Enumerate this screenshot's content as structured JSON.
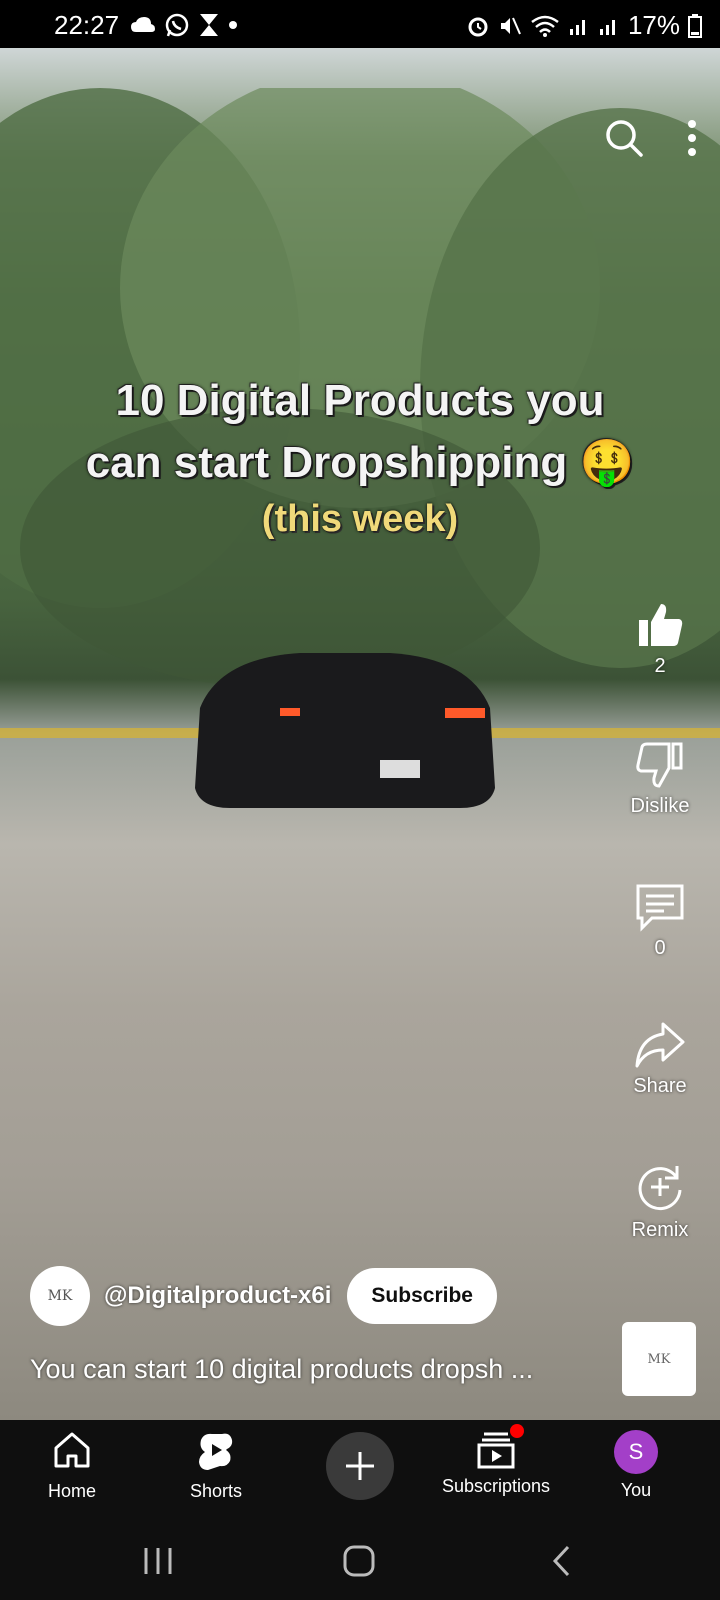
{
  "status": {
    "time": "22:27",
    "battery_pct": "17%"
  },
  "video": {
    "overlay_line1": "10 Digital Products you",
    "overlay_line2": "can start Dropshipping 🤑",
    "overlay_line3": "(this week)"
  },
  "actions": {
    "like_count": "2",
    "dislike_label": "Dislike",
    "comment_count": "0",
    "share_label": "Share",
    "remix_label": "Remix"
  },
  "channel": {
    "avatar_text": "MK",
    "handle": "@Digitalproduct-x6i",
    "subscribe_label": "Subscribe"
  },
  "title": "You can start 10 digital products dropsh ...",
  "thumb_text": "MK",
  "nav": {
    "home": "Home",
    "shorts": "Shorts",
    "subscriptions": "Subscriptions",
    "you": "You",
    "you_initial": "S"
  },
  "colors": {
    "nav_bg": "#0f0f0f",
    "notification_dot": "#ff0000",
    "you_avatar": "#a33fc8"
  }
}
